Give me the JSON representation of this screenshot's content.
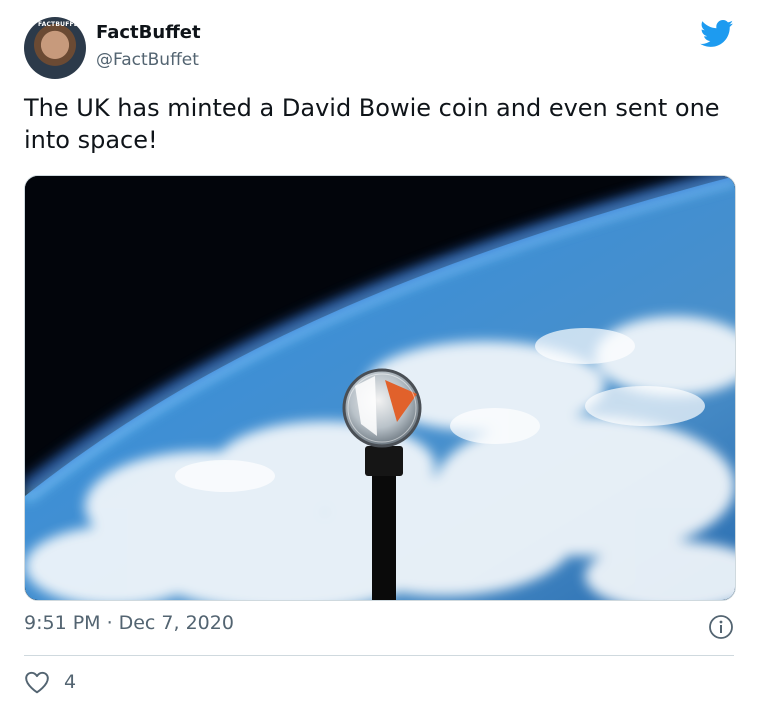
{
  "author": {
    "name": "FactBuffet",
    "handle": "@FactBuffet",
    "avatar_badge": "FACTBUFFET"
  },
  "tweet": {
    "text": "The UK has minted a David Bowie coin and even sent one into space!",
    "time": "9:51 PM",
    "separator": "·",
    "date": "Dec 7, 2020"
  },
  "actions": {
    "likes": "4"
  },
  "icons": {
    "brand": "twitter-bird-icon",
    "info": "info-icon",
    "like": "heart-icon"
  },
  "colors": {
    "twitter_blue": "#1d9bf0",
    "secondary_text": "#536471",
    "border": "#cfd9de"
  }
}
